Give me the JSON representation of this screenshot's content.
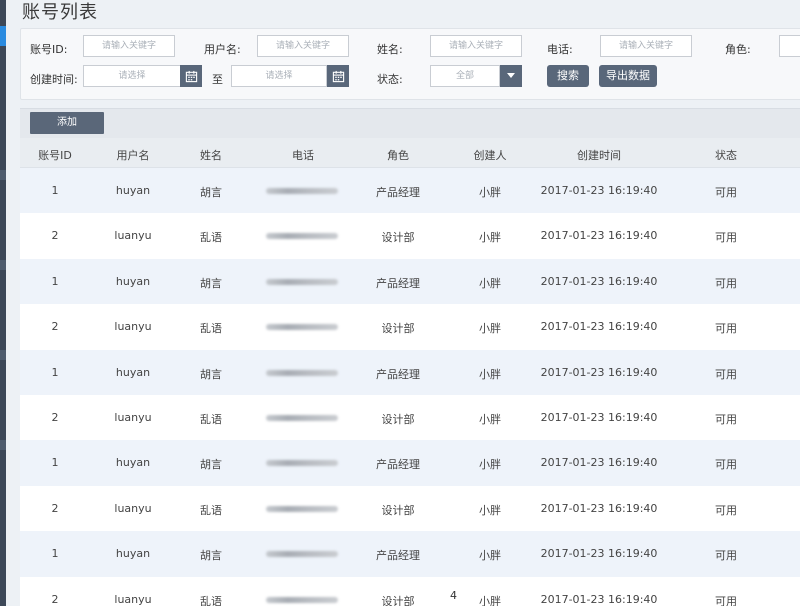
{
  "page_title": "账号列表",
  "filters": {
    "account_id_label": "账号ID:",
    "account_id_placeholder": "请输入关键字",
    "username_label": "用户名:",
    "username_placeholder": "请输入关键字",
    "name_label": "姓名:",
    "name_placeholder": "请输入关键字",
    "phone_label": "电话:",
    "phone_placeholder": "请输入关键字",
    "role_label": "角色:",
    "created_time_label": "创建时间:",
    "date_start_placeholder": "请选择",
    "to_label": "至",
    "date_end_placeholder": "请选择",
    "status_label": "状态:",
    "status_value": "全部",
    "search_button": "搜索",
    "export_button": "导出数据"
  },
  "toolbar": {
    "add_button": "添加"
  },
  "table": {
    "columns": [
      "账号ID",
      "用户名",
      "姓名",
      "电话",
      "角色",
      "创建人",
      "创建时间",
      "状态"
    ],
    "rows": [
      {
        "id": "1",
        "username": "huyan",
        "name": "胡言",
        "role": "产品经理",
        "creator": "小胖",
        "created": "2017-01-23 16:19:40",
        "status": "可用"
      },
      {
        "id": "2",
        "username": "luanyu",
        "name": "乱语",
        "role": "设计部",
        "creator": "小胖",
        "created": "2017-01-23 16:19:40",
        "status": "可用"
      },
      {
        "id": "1",
        "username": "huyan",
        "name": "胡言",
        "role": "产品经理",
        "creator": "小胖",
        "created": "2017-01-23 16:19:40",
        "status": "可用"
      },
      {
        "id": "2",
        "username": "luanyu",
        "name": "乱语",
        "role": "设计部",
        "creator": "小胖",
        "created": "2017-01-23 16:19:40",
        "status": "可用"
      },
      {
        "id": "1",
        "username": "huyan",
        "name": "胡言",
        "role": "产品经理",
        "creator": "小胖",
        "created": "2017-01-23 16:19:40",
        "status": "可用"
      },
      {
        "id": "2",
        "username": "luanyu",
        "name": "乱语",
        "role": "设计部",
        "creator": "小胖",
        "created": "2017-01-23 16:19:40",
        "status": "可用"
      },
      {
        "id": "1",
        "username": "huyan",
        "name": "胡言",
        "role": "产品经理",
        "creator": "小胖",
        "created": "2017-01-23 16:19:40",
        "status": "可用"
      },
      {
        "id": "2",
        "username": "luanyu",
        "name": "乱语",
        "role": "设计部",
        "creator": "小胖",
        "created": "2017-01-23 16:19:40",
        "status": "可用"
      },
      {
        "id": "1",
        "username": "huyan",
        "name": "胡言",
        "role": "产品经理",
        "creator": "小胖",
        "created": "2017-01-23 16:19:40",
        "status": "可用"
      },
      {
        "id": "2",
        "username": "luanyu",
        "name": "乱语",
        "role": "设计部",
        "creator": "小胖",
        "created": "2017-01-23 16:19:40",
        "status": "可用"
      }
    ],
    "stray_page_number": "4"
  },
  "colors": {
    "rail": "#3d4858",
    "rail_active": "#2a8be0",
    "button_dark": "#59677a",
    "row_alt": "#eef3fa",
    "link": "#4a8fe0"
  }
}
